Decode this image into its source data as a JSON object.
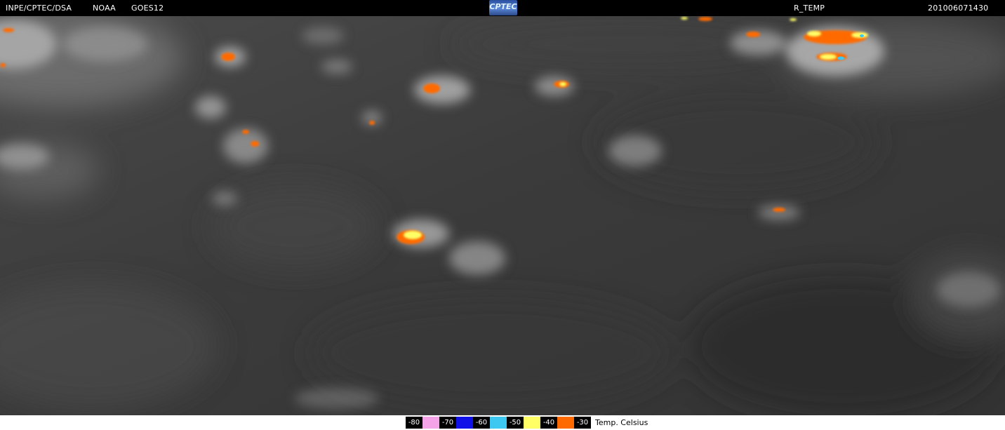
{
  "header": {
    "source": "INPE/CPTEC/DSA",
    "agency": "NOAA",
    "satellite": "GOES12",
    "logo_text": "CPTEC",
    "product": "R_TEMP",
    "timestamp": "201006071430"
  },
  "legend": {
    "items": [
      {
        "value": "-80",
        "color": "#f4a3e8"
      },
      {
        "value": "-70",
        "color": "#1010e8"
      },
      {
        "value": "-60",
        "color": "#3cc8f0"
      },
      {
        "value": "-50",
        "color": "#ffff66"
      },
      {
        "value": "-40",
        "color": "#ff6a00"
      },
      {
        "value": "-30",
        "color": null
      }
    ],
    "unit_label": "Temp. Celsius"
  },
  "colors": {
    "background": "#3a3a3a",
    "cold_top_orange": "#ff6a00",
    "cold_top_yellow": "#ffff66",
    "cold_top_cyan": "#3cc8f0"
  }
}
